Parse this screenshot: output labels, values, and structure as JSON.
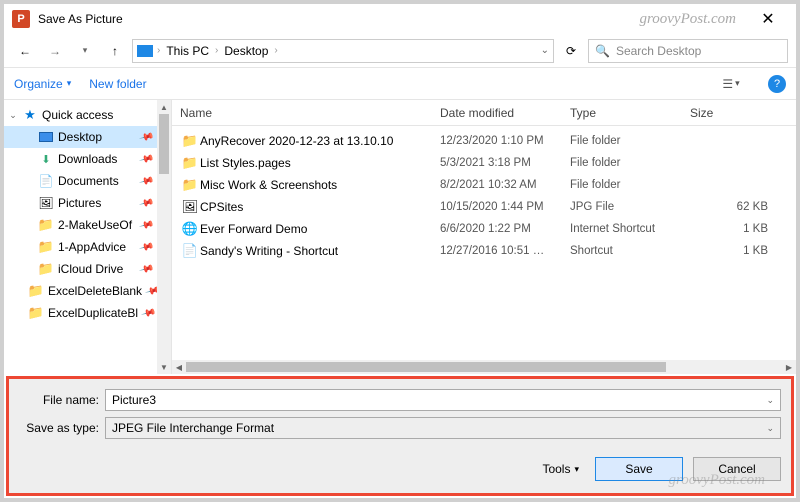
{
  "window": {
    "title": "Save As Picture",
    "app_icon_text": "P"
  },
  "watermark": "groovyPost.com",
  "nav": {
    "pc_label": "This PC",
    "folder_label": "Desktop",
    "search_placeholder": "Search Desktop",
    "refresh_glyph": "⟳"
  },
  "toolbar": {
    "organize": "Organize",
    "new_folder": "New folder",
    "help_glyph": "?"
  },
  "headers": {
    "name": "Name",
    "date": "Date modified",
    "type": "Type",
    "size": "Size"
  },
  "tree": {
    "quick_access": "Quick access",
    "items": [
      {
        "label": "Desktop",
        "icon": "monitor",
        "pinned": true,
        "selected": true
      },
      {
        "label": "Downloads",
        "icon": "dl",
        "pinned": true
      },
      {
        "label": "Documents",
        "icon": "doc",
        "pinned": true
      },
      {
        "label": "Pictures",
        "icon": "pic",
        "pinned": true
      },
      {
        "label": "2-MakeUseOf",
        "icon": "folder",
        "pinned": true
      },
      {
        "label": "1-AppAdvice",
        "icon": "folder",
        "pinned": true
      },
      {
        "label": "iCloud Drive",
        "icon": "folder",
        "pinned": true
      },
      {
        "label": "ExcelDeleteBlank",
        "icon": "folder",
        "pinned": true
      },
      {
        "label": "ExcelDuplicateBl",
        "icon": "folder",
        "pinned": true
      }
    ]
  },
  "files": [
    {
      "name": "AnyRecover 2020-12-23 at 13.10.10",
      "date": "12/23/2020 1:10 PM",
      "type": "File folder",
      "size": "",
      "icon": "📁"
    },
    {
      "name": "List Styles.pages",
      "date": "5/3/2021 3:18 PM",
      "type": "File folder",
      "size": "",
      "icon": "📁"
    },
    {
      "name": "Misc Work & Screenshots",
      "date": "8/2/2021 10:32 AM",
      "type": "File folder",
      "size": "",
      "icon": "📁"
    },
    {
      "name": "CPSites",
      "date": "10/15/2020 1:44 PM",
      "type": "JPG File",
      "size": "62 KB",
      "icon": "🖼"
    },
    {
      "name": "Ever Forward Demo",
      "date": "6/6/2020 1:22 PM",
      "type": "Internet Shortcut",
      "size": "1 KB",
      "icon": "🌐"
    },
    {
      "name": "Sandy's Writing - Shortcut",
      "date": "12/27/2016 10:51 …",
      "type": "Shortcut",
      "size": "1 KB",
      "icon": "📄"
    }
  ],
  "bottom": {
    "file_name_label": "File name:",
    "file_name_value": "Picture3",
    "save_type_label": "Save as type:",
    "save_type_value": "JPEG File Interchange Format",
    "tools": "Tools",
    "save": "Save",
    "cancel": "Cancel"
  }
}
